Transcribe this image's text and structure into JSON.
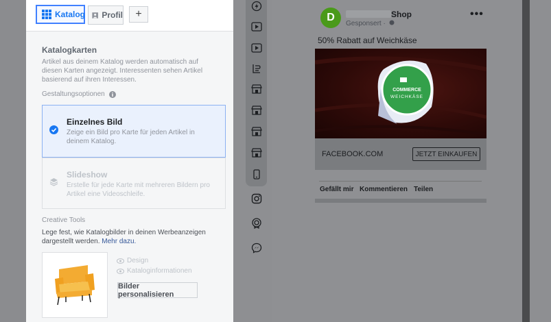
{
  "tabs": [
    {
      "label": "Katalog",
      "icon": "grid-icon",
      "active": true
    },
    {
      "label": "Profil",
      "icon": "profile-icon",
      "active": false
    },
    {
      "label": "+",
      "icon": "plus-icon",
      "active": false
    }
  ],
  "catalog_cards": {
    "heading": "Katalogkarten",
    "description": "Artikel aus deinem Katalog werden automatisch auf diesen Karten angezeigt. Interessenten sehen Artikel basierend auf ihren Interessen."
  },
  "design_options": {
    "heading": "Gestaltungsoptionen",
    "options": [
      {
        "title": "Einzelnes Bild",
        "description": "Zeige ein Bild pro Karte für jeden Artikel in deinem Katalog.",
        "selected": true
      },
      {
        "title": "Slideshow",
        "description": "Erstelle für jede Karte mit mehreren Bildern pro Artikel eine Videoschleife.",
        "selected": false
      }
    ]
  },
  "creative_tools": {
    "heading": "Creative Tools",
    "description": "Lege fest, wie Katalogbilder in deinen Werbeanzeigen dargestellt werden.",
    "link": "Mehr dazu.",
    "toggles": [
      "Design",
      "Kataloginformationen"
    ],
    "button": "Bilder personalisieren"
  },
  "placements": [
    "messenger-stories-icon",
    "video-icon",
    "video-icon",
    "instant-article-icon",
    "shop-icon",
    "shop-icon",
    "shop-icon",
    "shop-icon",
    "mobile-icon",
    "instagram-icon",
    "audience-network-icon",
    "messenger-icon"
  ],
  "ad_preview": {
    "avatar_letter": "D",
    "page_name": "Shop",
    "sponsored": "Gesponsert ·",
    "more": "•••",
    "primary_text": "50% Rabatt auf Weichkäse",
    "image_label_top": "COMMERCE",
    "image_label_bottom": "WEICHKÄSE",
    "domain": "FACEBOOK.COM",
    "cta": "JETZT EINKAUFEN",
    "actions": [
      "Gefällt mir",
      "Kommentieren",
      "Teilen"
    ]
  },
  "colors": {
    "accent": "#1877f2",
    "selected_bg": "#eaf1fd",
    "avatar": "#4a9a1a"
  }
}
